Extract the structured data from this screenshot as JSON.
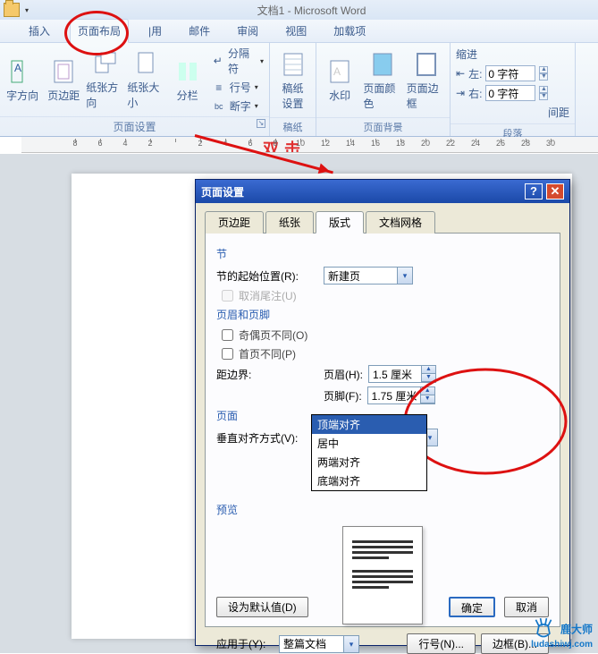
{
  "title": "文档1 - Microsoft Word",
  "ribbon_tabs": {
    "insert": "插入",
    "pagelayout": "页面布局",
    "references": "|用",
    "mailings": "邮件",
    "review": "审阅",
    "view": "视图",
    "addins": "加载项"
  },
  "groups": {
    "page_setup": {
      "text_direction": "字方向",
      "margins": "页边距",
      "orientation": "纸张方向",
      "size": "纸张大小",
      "columns": "分栏",
      "breaks": "分隔符",
      "line_numbers": "行号",
      "hyphenation": "断字",
      "label": "页面设置"
    },
    "grid_paper": {
      "btn": "稿纸\n设置",
      "label": "稿纸"
    },
    "page_background": {
      "watermark": "水印",
      "color": "页面颜色",
      "border": "页面边框",
      "label": "页面背景"
    },
    "indent": {
      "title": "缩进",
      "left": "左:",
      "right": "右:",
      "val_l": "0 字符",
      "val_r": "0 字符",
      "para": "间距"
    },
    "paragraph": {
      "label": "段落"
    }
  },
  "ruler_overlay": "双击",
  "dialog": {
    "title": "页面设置",
    "tabs": {
      "margin": "页边距",
      "paper": "纸张",
      "layout": "版式",
      "grid": "文档网格"
    },
    "section": {
      "label": "节",
      "start_label": "节的起始位置(R):",
      "start_value": "新建页",
      "suppress": "取消尾注(U)"
    },
    "header_footer": {
      "label": "页眉和页脚",
      "odd_even": "奇偶页不同(O)",
      "first": "首页不同(P)",
      "distance": "距边界:",
      "header_l": "页眉(H):",
      "header_v": "1.5 厘米",
      "footer_l": "页脚(F):",
      "footer_v": "1.75 厘米"
    },
    "page": {
      "label": "页面",
      "valign_l": "垂直对齐方式(V):",
      "valign_v": "顶端对齐",
      "options": {
        "top": "顶端对齐",
        "center": "居中",
        "justify": "两端对齐",
        "bottom": "底端对齐"
      }
    },
    "preview": {
      "label": "预览"
    },
    "apply_to_l": "应用于(Y):",
    "apply_to_v": "整篇文档",
    "line_numbers_btn": "行号(N)...",
    "borders_btn": "边框(B)...",
    "default_btn": "设为默认值(D)",
    "ok": "确定",
    "cancel": "取消"
  },
  "watermark": {
    "brand": "鹿大师",
    "url": "ludashiwj.com"
  },
  "ruler_numbers": [
    "8",
    "6",
    "4",
    "2",
    "",
    "2",
    "4",
    "6",
    "8",
    "10",
    "12",
    "14",
    "16",
    "18",
    "20",
    "22",
    "24",
    "26",
    "28",
    "30"
  ]
}
